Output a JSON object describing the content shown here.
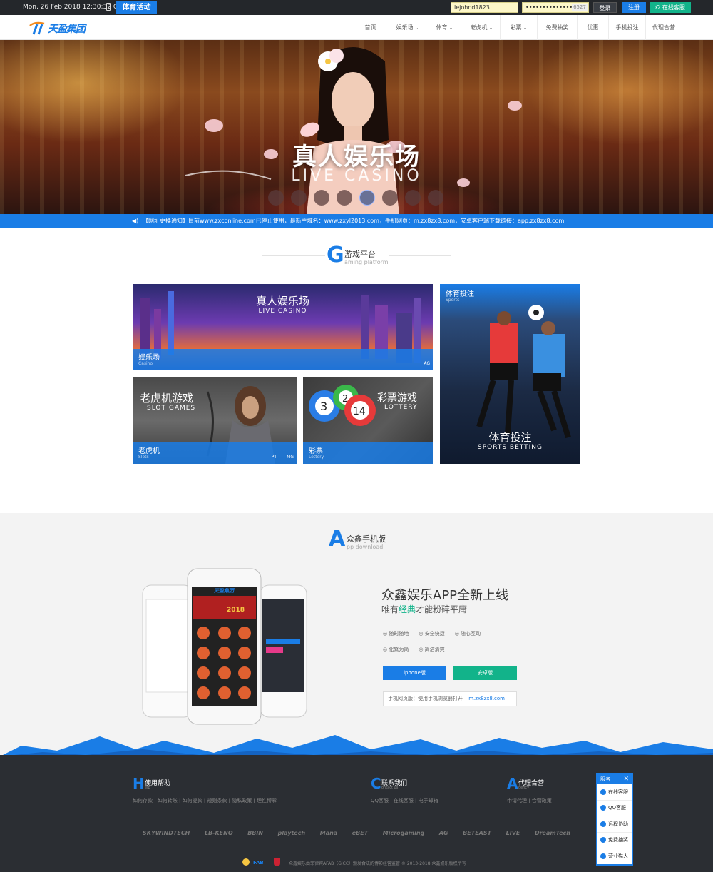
{
  "topbar": {
    "datetime": "Mon, 26 Feb 2018 12:30:32 GMT",
    "promo_label": "体育活动",
    "username_value": "lejohnd1823",
    "password_value": "••••••••••••••",
    "captcha": "6527",
    "login_label": "登录",
    "register_label": "注册",
    "support_label": "在线客服"
  },
  "nav": {
    "logo_text": "天盈集团",
    "items": [
      {
        "label": "首页"
      },
      {
        "label": "娱乐场"
      },
      {
        "label": "体育"
      },
      {
        "label": "老虎机"
      },
      {
        "label": "彩票"
      },
      {
        "label": "免费抽奖"
      },
      {
        "label": "优惠"
      },
      {
        "label": "手机投注"
      },
      {
        "label": "代理合营"
      }
    ]
  },
  "hero": {
    "title": "真人娱乐场",
    "subtitle": "LIVE CASINO",
    "slide_count": 8,
    "active_slide": 5
  },
  "notice": {
    "text": "【网址更换通知】目前www.zxconline.com已停止使用，最新主域名：www.zxyl2013.com，手机网页：m.zx8zx8.com，安卓客户端下载链接：app.zx8zx8.com"
  },
  "games_section": {
    "letter": "G",
    "title": "游戏平台",
    "subtitle": "aming platform",
    "cards": {
      "casino": {
        "big_title": "真人娱乐场",
        "big_sub": "LIVE CASINO",
        "label": "娱乐场",
        "sub": "Casino",
        "tags": "AG"
      },
      "sports": {
        "top_label": "体育投注",
        "top_sub": "Sports",
        "big_title": "体育投注",
        "big_sub": "SPORTS BETTING"
      },
      "slots": {
        "big_title": "老虎机游戏",
        "big_sub": "SLOT GAMES",
        "label": "老虎机",
        "sub": "Slots",
        "tag1": "PT",
        "tag2": "MG"
      },
      "lottery": {
        "big_title": "彩票游戏",
        "big_sub": "LOTTERY",
        "label": "彩票",
        "sub": "Lottery"
      }
    }
  },
  "app_section": {
    "letter": "A",
    "title": "众鑫手机版",
    "subtitle": "pp download",
    "headline": "众鑫娱乐APP全新上线",
    "tagline_pre": "唯有",
    "tagline_accent": "经典",
    "tagline_post": "才能粉碎平庸",
    "features": [
      "随时随地",
      "安全快捷",
      "随心互动",
      "化繁为简",
      "简洁清爽"
    ],
    "iphone_label": "iphone版",
    "android_label": "安卓版",
    "mobile_web_label": "手机网页版：使用手机浏览器打开",
    "mobile_web_url": "m.zx8zx8.com",
    "phone_logo": "天盈集团",
    "phone_banner": "2018"
  },
  "footer": {
    "cols": [
      {
        "letter": "H",
        "title": "使用帮助",
        "en": "elp",
        "links": "如何存款  |  如何转账  |  如何提款  |  规则条款  |  隐私政策  |  理性博彩"
      },
      {
        "letter": "C",
        "title": "联系我们",
        "en": "ontact us",
        "links": "QQ客服  |  在线客服  |  电子邮箱"
      },
      {
        "letter": "A",
        "title": "代理合营",
        "en": "gency",
        "links": "申请代理  |  合营政策"
      }
    ],
    "partners": [
      "SKYWINDTECH",
      "LB-KENO",
      "BBIN",
      "playtech",
      "Mana",
      "eBET",
      "Microgaming",
      "AG",
      "BETEAST",
      "LIVE",
      "DreamTech"
    ],
    "copyright": "众鑫娱乐由菲律宾AFAB（GICC）颁发合法的博彩经营监管 © 2013-2018 众鑫娱乐版权所有",
    "seal": "FAB"
  },
  "service": {
    "title": "服务",
    "items": [
      "在线客服",
      "QQ客服",
      "远程协助",
      "免费抽奖",
      "营业猫人"
    ]
  },
  "colors": {
    "accent": "#1a7de6",
    "green": "#12b38a",
    "dark": "#24272b",
    "footer": "#2b2e33"
  }
}
